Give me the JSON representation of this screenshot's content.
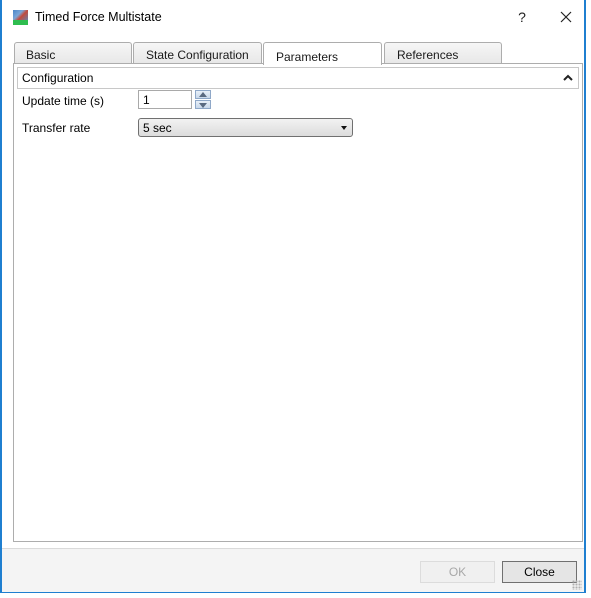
{
  "window": {
    "title": "Timed Force Multistate",
    "help_label": "?",
    "close_label": "✕",
    "border_color": "#1f7fd0"
  },
  "tabs": [
    {
      "label": "Basic",
      "active": false
    },
    {
      "label": "State Configuration",
      "active": false
    },
    {
      "label": "Parameters",
      "active": true
    },
    {
      "label": "References",
      "active": false
    }
  ],
  "section": {
    "title": "Configuration",
    "collapse_icon": "chevron-up-icon"
  },
  "fields": {
    "update_time": {
      "label": "Update time (s)",
      "value": "1"
    },
    "transfer_rate": {
      "label": "Transfer rate",
      "value": "5 sec"
    }
  },
  "footer": {
    "ok_label": "OK",
    "ok_enabled": false,
    "close_label": "Close"
  }
}
